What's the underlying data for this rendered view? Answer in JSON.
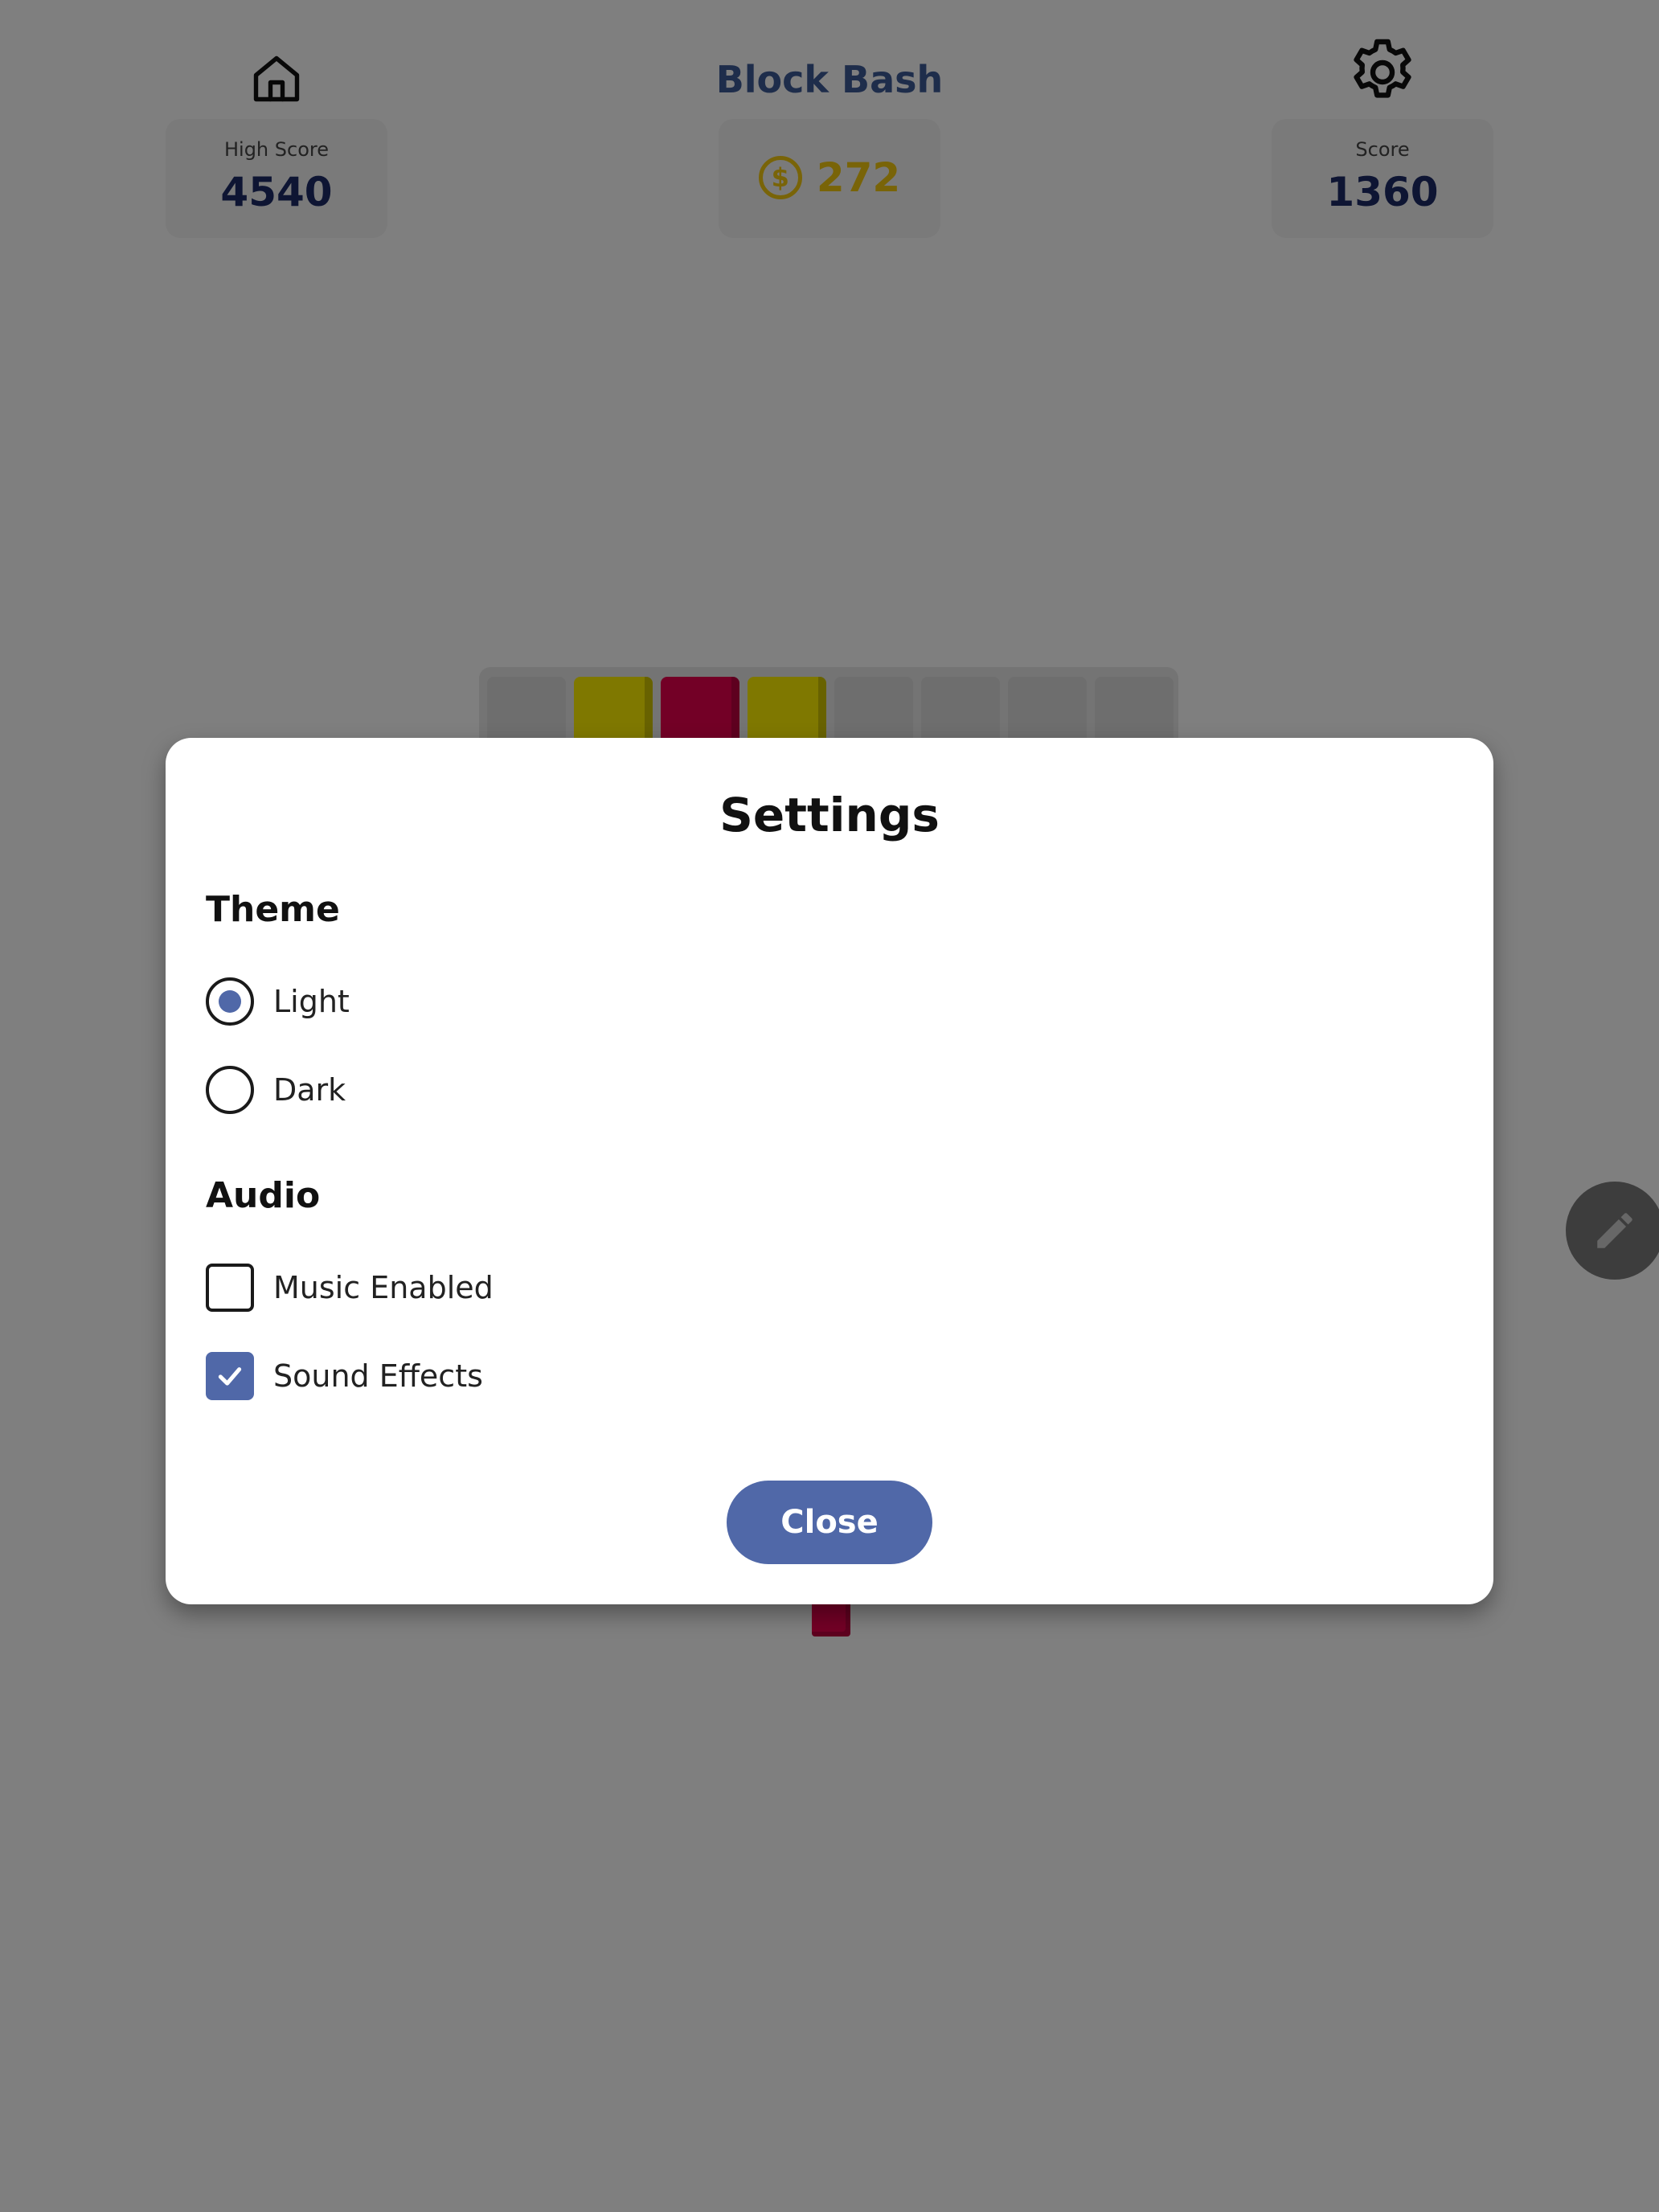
{
  "header": {
    "title": "Block Bash",
    "home_icon": "home-icon",
    "settings_icon": "gear-icon",
    "high_score": {
      "label": "High Score",
      "value": "4540"
    },
    "coins": {
      "value": "272",
      "icon": "dollar-coin-icon"
    },
    "score": {
      "label": "Score",
      "value": "1360"
    }
  },
  "board": {
    "visible_row": [
      "empty",
      "yellow",
      "crimson",
      "yellow",
      "empty",
      "empty",
      "empty",
      "empty"
    ]
  },
  "fab": {
    "icon": "pencil-icon"
  },
  "dialog": {
    "title": "Settings",
    "theme": {
      "title": "Theme",
      "options": [
        {
          "label": "Light",
          "selected": true
        },
        {
          "label": "Dark",
          "selected": false
        }
      ]
    },
    "audio": {
      "title": "Audio",
      "options": [
        {
          "label": "Music Enabled",
          "checked": false
        },
        {
          "label": "Sound Effects",
          "checked": true
        }
      ]
    },
    "close_label": "Close"
  },
  "colors": {
    "accent": "#5068a8",
    "title_blue": "#3d5a96",
    "score_navy": "#1c2b66",
    "coin_gold": "#f2c811",
    "block_yellow": "#fff000",
    "block_crimson": "#e6004c",
    "overlay": "rgba(0,0,0,0.5)"
  }
}
